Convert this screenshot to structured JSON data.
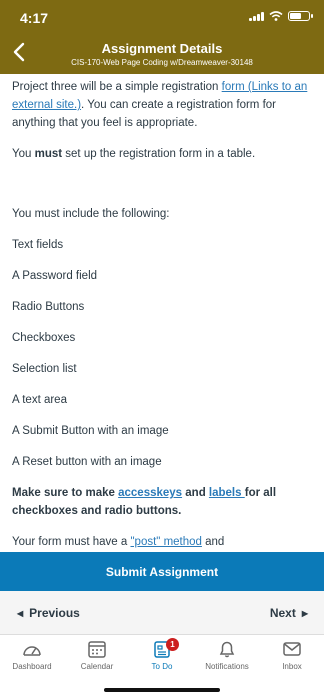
{
  "status": {
    "time": "4:17"
  },
  "header": {
    "title": "Assignment Details",
    "subtitle": "CIS-170-Web Page Coding w/Dreamweaver-30148"
  },
  "content": {
    "intro_before": "Project three will be a simple registration ",
    "intro_link": "form (Links to an external site.)",
    "intro_after": ". You can create a registration form for anything that you feel is appropriate.",
    "must_before": "You ",
    "must_bold": "must",
    "must_after": " set up the registration form in a table.",
    "include_heading": "You must include the following:",
    "items": [
      "Text fields",
      "A Password field",
      "Radio Buttons",
      "Checkboxes",
      "Selection list",
      "A text area",
      "A Submit Button with an image",
      "A Reset button with an image"
    ],
    "note_before": "Make sure to make ",
    "note_link1": "accesskeys",
    "note_mid": " and ",
    "note_link2": "labels ",
    "note_after": " for all checkboxes and radio buttons.",
    "partial_before": "Your form must have a ",
    "partial_link": "\"post\" method",
    "partial_after": " and"
  },
  "submit_label": "Submit Assignment",
  "pager": {
    "previous": "Previous",
    "next": "Next"
  },
  "tabs": [
    {
      "label": "Dashboard",
      "icon": "dashboard-icon"
    },
    {
      "label": "Calendar",
      "icon": "calendar-icon"
    },
    {
      "label": "To Do",
      "icon": "todo-icon",
      "badge": "1",
      "active": true
    },
    {
      "label": "Notifications",
      "icon": "bell-icon"
    },
    {
      "label": "Inbox",
      "icon": "inbox-icon"
    }
  ],
  "colors": {
    "header": "#7e6a12",
    "submit": "#0b7ab8",
    "link": "#2a7ab8",
    "badge": "#cc1f1f"
  }
}
